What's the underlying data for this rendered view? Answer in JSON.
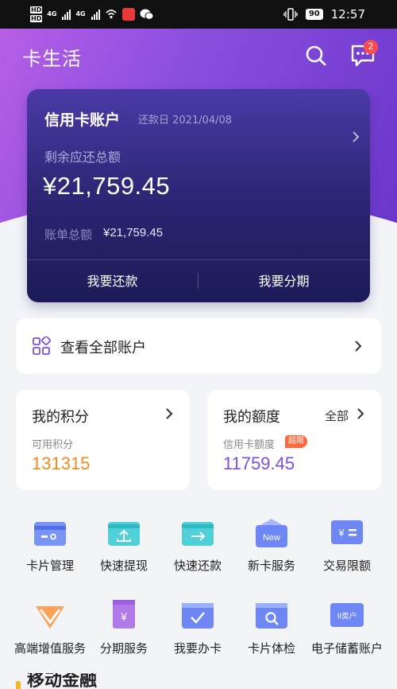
{
  "status_bar": {
    "hd1": "HD",
    "hd2": "HD",
    "net1": "4G",
    "net2": "4G",
    "battery": "90",
    "time": "12:57"
  },
  "header": {
    "title": "卡生活",
    "search_icon": "search-icon",
    "message_icon": "message-icon",
    "message_badge": "2"
  },
  "credit_card": {
    "title": "信用卡账户",
    "due_date": "还款日 2021/04/08",
    "remaining_label": "剩余应还总额",
    "remaining_amount": "¥21,759.45",
    "bill_total_label": "账单总额",
    "bill_total_value": "¥21,759.45",
    "repay_button": "我要还款",
    "installment_button": "我要分期"
  },
  "all_accounts": {
    "label": "查看全部账户",
    "icon": "grid-icon"
  },
  "points": {
    "title": "我的积分",
    "sub": "可用积分",
    "value": "131315",
    "value_color": "#f28a1f"
  },
  "limit": {
    "title": "我的额度",
    "all_label": "全部",
    "sub": "信用卡额度",
    "badge": "超限",
    "value": "11759.45",
    "value_color": "#7a4fe0"
  },
  "services": [
    {
      "label": "卡片管理",
      "icon": "card-manage-icon"
    },
    {
      "label": "快速提现",
      "icon": "quick-withdraw-icon"
    },
    {
      "label": "快速还款",
      "icon": "quick-repay-icon"
    },
    {
      "label": "新卡服务",
      "icon": "new-card-icon",
      "icon_text": "New"
    },
    {
      "label": "交易限额",
      "icon": "transaction-limit-icon",
      "icon_text": "¥"
    },
    {
      "label": "高端增值服务",
      "icon": "premium-service-icon"
    },
    {
      "label": "分期服务",
      "icon": "installment-service-icon",
      "icon_text": "¥"
    },
    {
      "label": "我要办卡",
      "icon": "apply-card-icon"
    },
    {
      "label": "卡片体检",
      "icon": "card-checkup-icon"
    },
    {
      "label": "电子储蓄账户",
      "icon": "e-savings-icon",
      "icon_text": "II类户"
    }
  ],
  "section_peek": {
    "title": "移动金融"
  }
}
